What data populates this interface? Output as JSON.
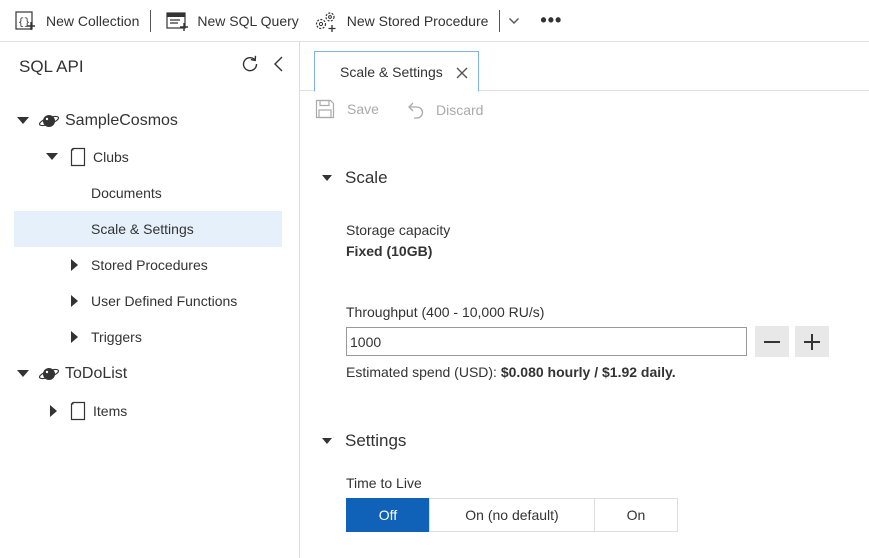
{
  "toolbar": {
    "new_collection": "New Collection",
    "new_sql_query": "New SQL Query",
    "new_stored_procedure": "New Stored Procedure",
    "more": "•••"
  },
  "sidebar": {
    "title": "SQL API",
    "tree": {
      "db1": "SampleCosmos",
      "db1_coll": "Clubs",
      "documents": "Documents",
      "scale_settings": "Scale & Settings",
      "stored_procedures": "Stored Procedures",
      "udfs": "User Defined Functions",
      "triggers": "Triggers",
      "db2": "ToDoList",
      "db2_coll": "Items"
    }
  },
  "main": {
    "tab_label": "Scale & Settings",
    "save_label": "Save",
    "discard_label": "Discard",
    "scale_header": "Scale",
    "storage_label": "Storage capacity",
    "storage_value": "Fixed (10GB)",
    "throughput_label": "Throughput (400 - 10,000 RU/s)",
    "throughput_value": "1000",
    "spend_prefix": "Estimated spend (USD): ",
    "spend_value": "$0.080 hourly / $1.92 daily.",
    "settings_header": "Settings",
    "ttl_label": "Time to Live",
    "ttl_options": [
      "Off",
      "On (no default)",
      "On"
    ],
    "ttl_selected": "Off"
  },
  "colors": {
    "accent": "#0f62b8",
    "selected_row": "#e6f0fb",
    "tab_border": "#7fb2e8",
    "disabled_text": "#aaaaaa"
  }
}
